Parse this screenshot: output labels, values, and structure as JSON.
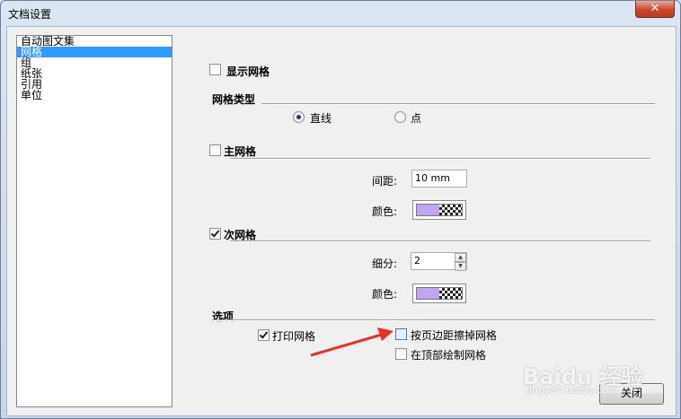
{
  "window": {
    "title": "文档设置",
    "close_glyph": "✕"
  },
  "tree": {
    "items": [
      {
        "label": "自动图文集",
        "selected": false
      },
      {
        "label": "网格",
        "selected": true
      },
      {
        "label": "组",
        "selected": false
      },
      {
        "label": "纸张",
        "selected": false
      },
      {
        "label": "引用",
        "selected": false
      },
      {
        "label": "单位",
        "selected": false
      }
    ]
  },
  "grid": {
    "show_grid": {
      "label": "显示网格",
      "checked": false
    },
    "grid_type": {
      "title": "网格类型",
      "options": [
        {
          "label": "直线",
          "selected": true
        },
        {
          "label": "点",
          "selected": false
        }
      ]
    },
    "major": {
      "label": "主网格",
      "checked": false,
      "spacing_label": "间距:",
      "spacing_value": "10 mm",
      "color_label": "颜色:"
    },
    "minor": {
      "label": "次网格",
      "checked": true,
      "subdiv_label": "细分:",
      "subdiv_value": "2",
      "color_label": "颜色:"
    },
    "options": {
      "title": "选项",
      "print_grid": {
        "label": "打印网格",
        "checked": true
      },
      "erase_by_margin": {
        "label": "按页边距擦掉网格",
        "checked": false
      },
      "draw_on_top": {
        "label": "在顶部绘制网格",
        "checked": false
      }
    }
  },
  "buttons": {
    "close_label": "关闭"
  },
  "watermark": {
    "text": "Baidu 经验",
    "sub": "jingyan.baidu.com"
  },
  "colors": {
    "swatch": "#c0a6f1",
    "arrow": "#e8302a",
    "selection": "#3399ff"
  }
}
